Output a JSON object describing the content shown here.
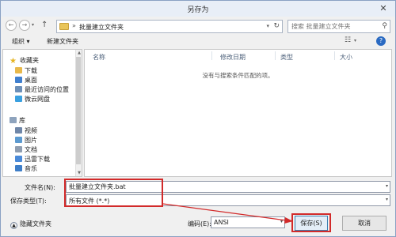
{
  "window": {
    "title": "另存为",
    "close": "✕"
  },
  "address": {
    "back": "←",
    "forward": "→",
    "dropdown": "▾",
    "up": "↑",
    "separator": "»",
    "path": "批量建立文件夹",
    "refresh": "↻",
    "search_placeholder": "搜索 批量建立文件夹",
    "search_icon": "⚲"
  },
  "toolbar": {
    "organize": "组织 ▾",
    "new_folder": "新建文件夹",
    "view_icon": "☷",
    "view_dropdown": "▾",
    "help": "?"
  },
  "nav": {
    "favorites_header": "收藏夹",
    "favorites": [
      {
        "label": "下载",
        "icon": "download-folder-icon",
        "color": "#e8b84a"
      },
      {
        "label": "桌面",
        "icon": "desktop-icon",
        "color": "#3f7fcf"
      },
      {
        "label": "最近访问的位置",
        "icon": "recent-places-icon",
        "color": "#6c8fb8"
      },
      {
        "label": "微云网盘",
        "icon": "cloud-drive-icon",
        "color": "#3aa0e0"
      }
    ],
    "library_header": "库",
    "libraries": [
      {
        "label": "视频",
        "icon": "video-library-icon",
        "color": "#6f86a8"
      },
      {
        "label": "图片",
        "icon": "pictures-library-icon",
        "color": "#5c9ad0"
      },
      {
        "label": "文档",
        "icon": "documents-library-icon",
        "color": "#8f9db0"
      },
      {
        "label": "迅雷下载",
        "icon": "thunder-download-icon",
        "color": "#4a8ad8"
      },
      {
        "label": "音乐",
        "icon": "music-library-icon",
        "color": "#3e7ec8"
      }
    ],
    "scroll_up": "▲",
    "scroll_down": "▼"
  },
  "filelist": {
    "columns": [
      "名称",
      "修改日期",
      "类型",
      "大小"
    ],
    "empty_message": "没有与搜索条件匹配的项。"
  },
  "form": {
    "filename_label": "文件名(N):",
    "filename_value": "批量建立文件夹.bat",
    "filetype_label": "保存类型(T):",
    "filetype_value": "所有文件  (*.*)",
    "encoding_label": "编码(E):",
    "encoding_value": "ANSI",
    "dropdown": "▾"
  },
  "bottom": {
    "hide_folders_arrow": "▲",
    "hide_folders": "隐藏文件夹",
    "save": "保存(S)",
    "cancel": "取消"
  },
  "colors": {
    "annotation_red": "#d22a2a",
    "accent_blue": "#2a6ac2"
  }
}
